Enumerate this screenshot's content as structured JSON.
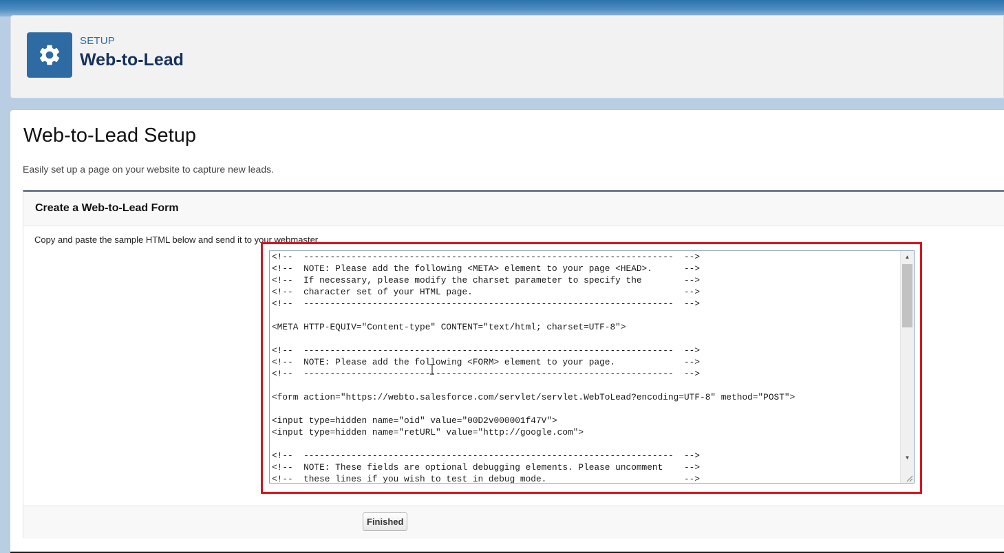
{
  "header": {
    "eyebrow": "SETUP",
    "title": "Web-to-Lead",
    "icon": "gear-icon"
  },
  "page": {
    "title": "Web-to-Lead Setup",
    "description": "Easily set up a page on your website to capture new leads."
  },
  "section": {
    "title": "Create a Web-to-Lead Form",
    "instruction": "Copy and paste the sample HTML below and send it to your webmaster.",
    "code_lines": [
      "<!--  ----------------------------------------------------------------------  -->",
      "<!--  NOTE: Please add the following <META> element to your page <HEAD>.      -->",
      "<!--  If necessary, please modify the charset parameter to specify the        -->",
      "<!--  character set of your HTML page.                                        -->",
      "<!--  ----------------------------------------------------------------------  -->",
      "",
      "<META HTTP-EQUIV=\"Content-type\" CONTENT=\"text/html; charset=UTF-8\">",
      "",
      "<!--  ----------------------------------------------------------------------  -->",
      "<!--  NOTE: Please add the following <FORM> element to your page.             -->",
      "<!--  ----------------------------------------------------------------------  -->",
      "",
      "<form action=\"https://webto.salesforce.com/servlet/servlet.WebToLead?encoding=UTF-8\" method=\"POST\">",
      "",
      "<input type=hidden name=\"oid\" value=\"00D2v000001f47V\">",
      "<input type=hidden name=\"retURL\" value=\"http://google.com\">",
      "",
      "<!--  ----------------------------------------------------------------------  -->",
      "<!--  NOTE: These fields are optional debugging elements. Please uncomment    -->",
      "<!--  these lines if you wish to test in debug mode.                          -->"
    ],
    "finish_label": "Finished"
  },
  "colors": {
    "accent": "#2f6ba3",
    "highlight": "#d9141c",
    "title_text": "#16325c"
  }
}
